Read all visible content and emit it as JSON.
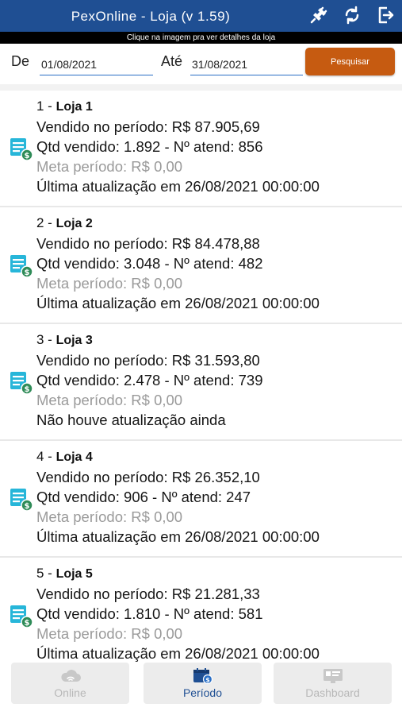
{
  "header": {
    "title": "PexOnline - Loja  (v 1.59)",
    "subtitle": "Clique na imagem pra ver detalhes da loja",
    "icons": [
      "plug-icon",
      "refresh-icon",
      "logout-icon"
    ]
  },
  "filter": {
    "from_label": "De",
    "from_value": "01/08/2021",
    "to_label": "Até",
    "to_value": "31/08/2021",
    "search_label": "Pesquisar"
  },
  "stores": [
    {
      "num": "1 - ",
      "name": "Loja 1",
      "sold": "Vendido no período: R$ 87.905,69",
      "qty": "Qtd vendido: 1.892 - Nº atend: 856",
      "goal": "Meta período: R$ 0,00",
      "updated": "Última atualização em 26/08/2021 00:00:00"
    },
    {
      "num": "2 - ",
      "name": "Loja 2",
      "sold": "Vendido no período: R$ 84.478,88",
      "qty": "Qtd vendido: 3.048 - Nº atend: 482",
      "goal": "Meta período: R$ 0,00",
      "updated": "Última atualização em 26/08/2021 00:00:00"
    },
    {
      "num": "3 - ",
      "name": "Loja 3",
      "sold": "Vendido no período: R$ 31.593,80",
      "qty": "Qtd vendido: 2.478 - Nº atend: 739",
      "goal": "Meta período: R$ 0,00",
      "updated": "Não houve atualização ainda"
    },
    {
      "num": "4 - ",
      "name": "Loja 4",
      "sold": "Vendido no período: R$ 26.352,10",
      "qty": "Qtd vendido: 906 - Nº atend: 247",
      "goal": "Meta período: R$ 0,00",
      "updated": "Última atualização em 26/08/2021 00:00:00"
    },
    {
      "num": "5 - ",
      "name": "Loja 5",
      "sold": "Vendido no período: R$ 21.281,33",
      "qty": "Qtd vendido: 1.810 - Nº atend: 581",
      "goal": "Meta período: R$ 0,00",
      "updated": "Última atualização em 26/08/2021 00:00:00"
    }
  ],
  "nav": {
    "online_label": "Online",
    "periodo_label": "Período",
    "dashboard_label": "Dashboard",
    "active": "periodo"
  },
  "colors": {
    "header": "#1f4f93",
    "search_button": "#c65b11",
    "store_icon": "#27b6d9",
    "store_badge": "#2e8b57"
  }
}
